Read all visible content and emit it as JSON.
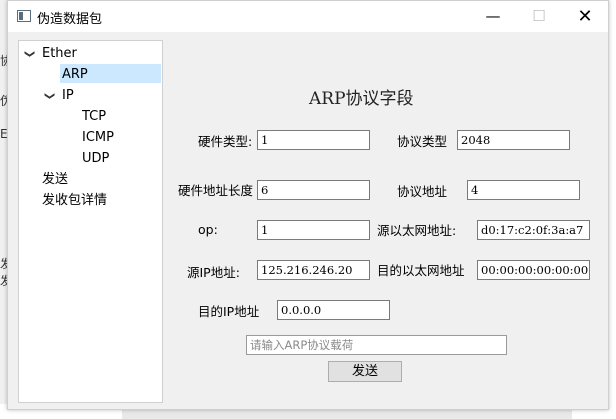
{
  "window": {
    "title": "伪造数据包",
    "minimize_glyph": "—",
    "maximize_glyph": "☐",
    "close_glyph": "✕"
  },
  "icons": [
    "app-icon",
    "chevron-down-icon",
    "minimize-icon",
    "maximize-icon",
    "close-icon"
  ],
  "colors": {
    "selection": "#cce8ff",
    "panel": "#f0f0f0"
  },
  "tree": {
    "ether": "Ether",
    "arp": "ARP",
    "ip": "IP",
    "tcp": "TCP",
    "icmp": "ICMP",
    "udp": "UDP",
    "send": "发送",
    "details": "发收包详情",
    "selected": "ARP"
  },
  "form": {
    "heading": "ARP协议字段",
    "hw_type_label": "硬件类型:",
    "hw_type_value": "1",
    "proto_type_label": "协议类型",
    "proto_type_value": "2048",
    "hw_len_label": "硬件地址长度",
    "hw_len_value": "6",
    "proto_addr_label": "协议地址",
    "proto_addr_value": "4",
    "op_label": "op:",
    "op_value": "1",
    "src_mac_label": "源以太网地址:",
    "src_mac_value": "d0:17:c2:0f:3a:a7",
    "src_ip_label": "源IP地址:",
    "src_ip_value": "125.216.246.20",
    "dst_mac_label": "目的以太网地址",
    "dst_mac_value": "00:00:00:00:00:00",
    "dst_ip_label": "目的IP地址",
    "dst_ip_value": "0.0.0.0",
    "payload_placeholder": "请输入ARP协议载荷",
    "send_button": "发送"
  },
  "background": {
    "fragments": [
      "协",
      "伪",
      "E",
      "发",
      "发"
    ]
  }
}
